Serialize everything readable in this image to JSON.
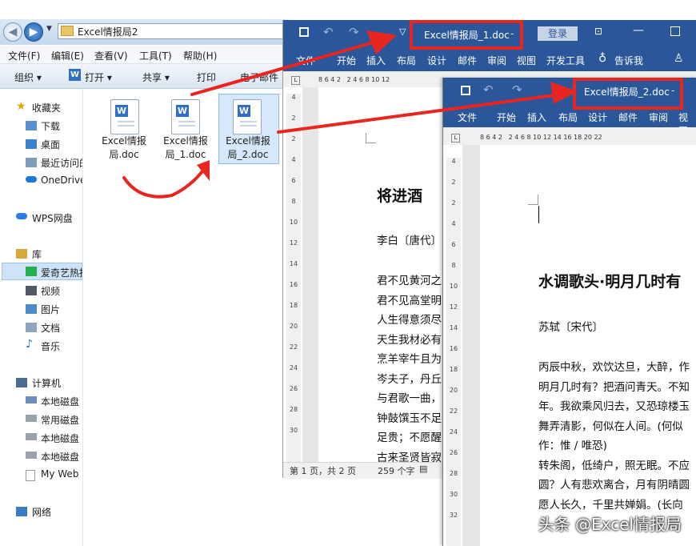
{
  "explorer": {
    "address": "Excel情报局2",
    "menu": [
      "文件(F)",
      "编辑(E)",
      "查看(V)",
      "工具(T)",
      "帮助(H)"
    ],
    "toolbar": {
      "organize": "组织 ▾",
      "open": "打开 ▾",
      "share": "共享 ▾",
      "print": "打印",
      "more": "电子邮件"
    },
    "nav": {
      "favorites": "收藏夹",
      "downloads": "下载",
      "desktop": "桌面",
      "recent": "最近访问的位置",
      "onedrive": "OneDrive",
      "wps": "WPS网盘",
      "library": "库",
      "iqiyi": "爱奇艺热播",
      "video": "视频",
      "pictures": "图片",
      "documents": "文档",
      "music": "音乐",
      "computer": "计算机",
      "disk1": "本地磁盘",
      "disk2": "常用磁盘",
      "disk3": "本地磁盘",
      "disk4": "本地磁盘",
      "myweb": "My Web",
      "network": "网络"
    },
    "files": [
      {
        "line1": "Excel情报",
        "line2": "局.doc"
      },
      {
        "line1": "Excel情报",
        "line2": "局_1.doc"
      },
      {
        "line1": "Excel情报",
        "line2": "局_2.doc"
      }
    ]
  },
  "word1": {
    "title": "Excel情报局_1.doc",
    "title_suffix": "-",
    "login": "登录",
    "tabs": [
      "文件",
      "开始",
      "插入",
      "布局",
      "设计",
      "邮件",
      "审阅",
      "视图",
      "开发工具"
    ],
    "tell": "告诉我",
    "ruler": "8 6 4 2   2 4 6 8 10 12",
    "vruler": [
      "4",
      "2",
      "2",
      "4",
      "6",
      "8",
      "10",
      "12",
      "14",
      "16",
      "18",
      "20",
      "22",
      "24",
      "26",
      "28",
      "30"
    ],
    "heading": "将进酒",
    "author": "李白〔唐代〕",
    "lines": [
      "君不见黄河之",
      "君不见高堂明",
      "人生得意须尽",
      "天生我材必有",
      "烹羊宰牛且为",
      "岑夫子，丹丘",
      "与君歌一曲，",
      "钟鼓馔玉不足",
      "足贵；不愿醒",
      "古来圣贤皆寂"
    ],
    "status_page": "第 1 页，共 2 页",
    "status_words": "259 个字"
  },
  "word2": {
    "title": "Excel情报局_2.doc",
    "title_suffix": "-",
    "tabs": [
      "文件",
      "开始",
      "插入",
      "布局",
      "设计",
      "邮件",
      "审阅",
      "视图"
    ],
    "ruler": "8 6 4 2   2 4 6 8 10 12 14 16 18 20 22",
    "vruler": [
      "4",
      "2",
      "2",
      "4",
      "6",
      "8",
      "10",
      "12",
      "14",
      "16",
      "18",
      "20",
      "22",
      "24",
      "26",
      "28",
      "30",
      "32"
    ],
    "heading": "水调歌头·明月几时有",
    "author": "苏轼〔宋代〕",
    "lines": [
      "丙辰中秋，欢饮达旦，大醉，作",
      "明月几时有？把酒问青天。不知",
      "年。我欲乘风归去，又恐琼楼玉",
      "舞弄清影，何似在人间。(何似",
      "作：惟 / 唯恐)",
      "转朱阁，低绮户，照无眠。不应",
      "圆？人有悲欢离合，月有阴晴圆",
      "愿人长久，千里共婵娟。(长向"
    ]
  },
  "watermark": "头条 @Excel情报局",
  "colors": {
    "word_blue": "#2b579a",
    "highlight_red": "#e8261f"
  }
}
